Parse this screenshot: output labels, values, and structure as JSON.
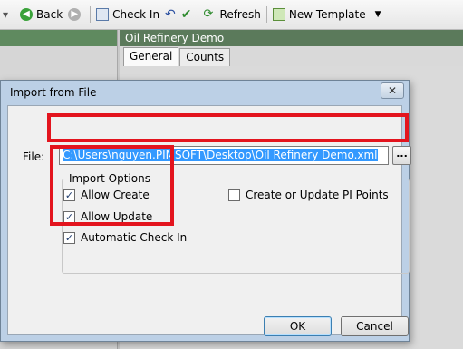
{
  "toolbar": {
    "back_label": "Back",
    "checkin_label": "Check In",
    "refresh_label": "Refresh",
    "new_template_label": "New Template"
  },
  "panel": {
    "title": "Oil Refinery Demo",
    "tabs": [
      "General",
      "Counts"
    ]
  },
  "dialog": {
    "title": "Import from File",
    "close_label": "✕",
    "file_label": "File:",
    "file_value": "C:\\Users\\nguyen.PIMSOFT\\Desktop\\Oil Refinery Demo.xml",
    "browse_label": "...",
    "group_label": "Import Options",
    "options": [
      {
        "label": "Allow Create",
        "checked": true
      },
      {
        "label": "Allow Update",
        "checked": true
      },
      {
        "label": "Automatic Check In",
        "checked": true
      },
      {
        "label": "Create or Update PI Points",
        "checked": false
      }
    ],
    "ok_label": "OK",
    "cancel_label": "Cancel"
  },
  "colors": {
    "highlight_red": "#e3141e",
    "selection_blue": "#3399ff",
    "panel_header_green": "#5b7a5b"
  }
}
